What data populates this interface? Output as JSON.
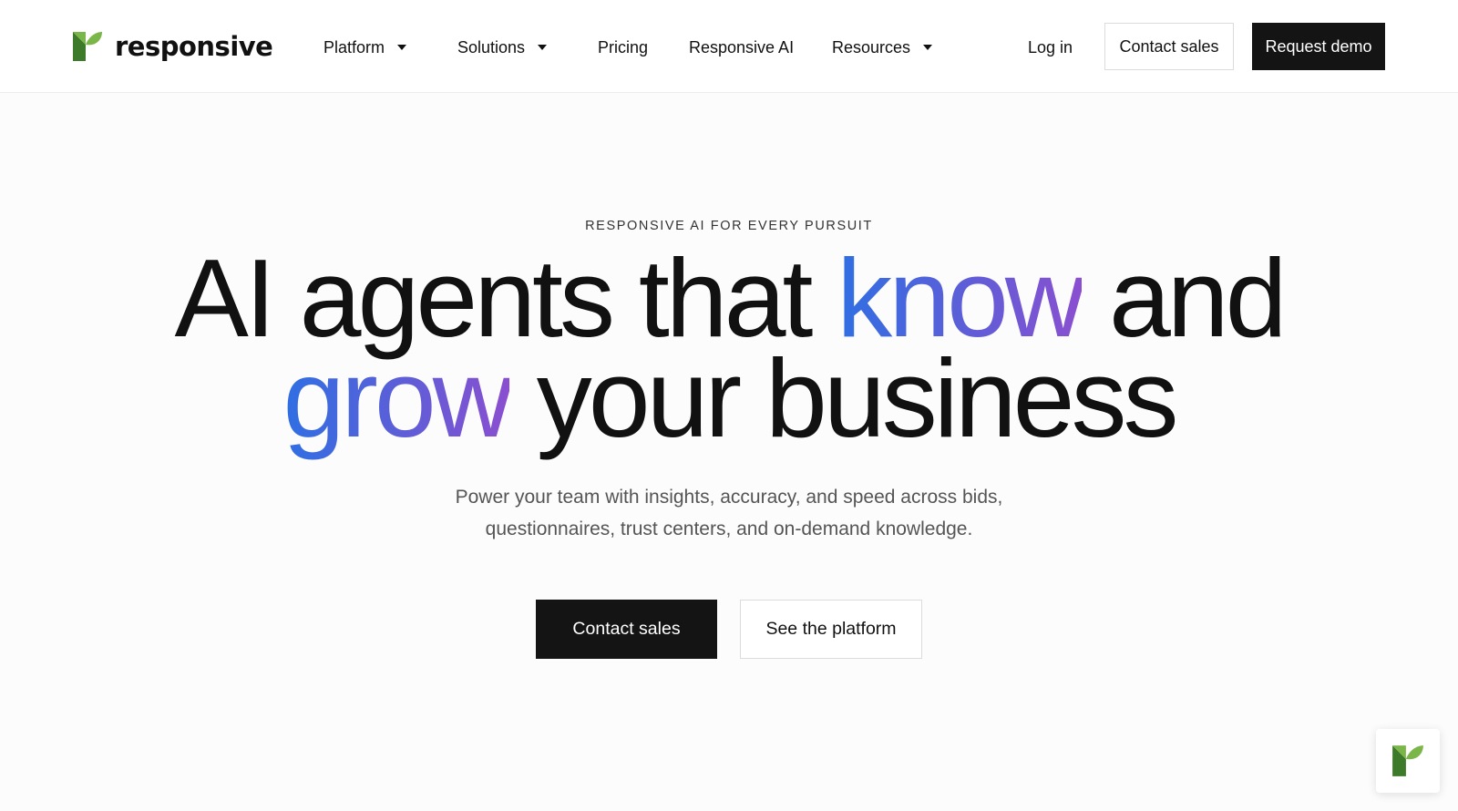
{
  "brand": {
    "name": "responsive",
    "logo_icon": "responsive-leaf-icon",
    "colors": {
      "leaf_dark": "#3d7a2a",
      "leaf_light": "#7ab648"
    }
  },
  "nav": {
    "items": [
      {
        "label": "Platform",
        "has_dropdown": true
      },
      {
        "label": "Solutions",
        "has_dropdown": true
      },
      {
        "label": "Pricing",
        "has_dropdown": false
      },
      {
        "label": "Responsive AI",
        "has_dropdown": false
      },
      {
        "label": "Resources",
        "has_dropdown": true
      }
    ],
    "login_label": "Log in",
    "contact_sales_label": "Contact sales",
    "request_demo_label": "Request demo"
  },
  "hero": {
    "eyebrow": "RESPONSIVE AI FOR EVERY PURSUIT",
    "headline": {
      "part1": "AI agents that ",
      "highlight1": "know",
      "part2": " and",
      "highlight2": "grow",
      "part3": " your business"
    },
    "subtext_line1": "Power your team with insights, accuracy, and speed across bids,",
    "subtext_line2": "questionnaires, trust centers, and on-demand knowledge.",
    "primary_cta": "Contact sales",
    "secondary_cta": "See the platform"
  },
  "theme": {
    "gradient_start": "#2f6fe3",
    "gradient_end": "#8a4fd0",
    "dark_button": "#141414"
  },
  "chat_widget": {
    "icon": "responsive-leaf-icon"
  }
}
